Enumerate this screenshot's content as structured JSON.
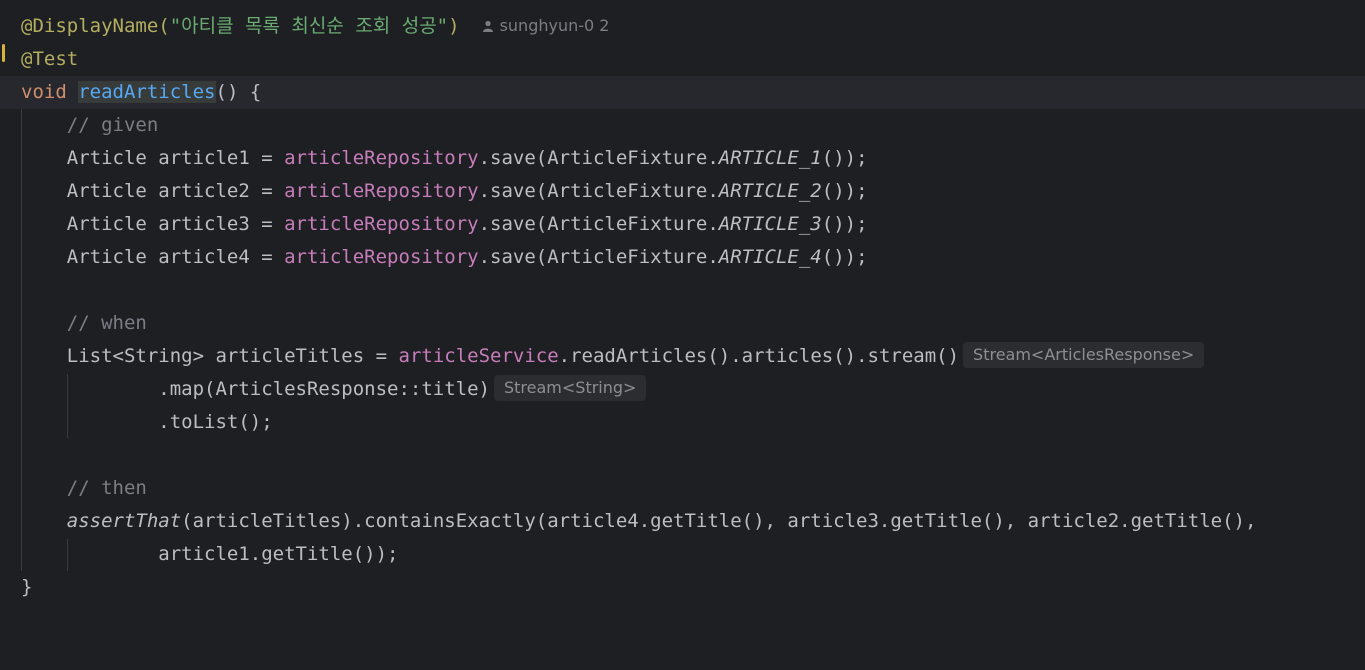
{
  "lines": [
    {
      "a": "@DisplayName(",
      "b": "\"아티클 목록 최신순 조회 성공\"",
      "c": ")"
    },
    {
      "a": "@Test"
    },
    {
      "a": "void",
      "b": " ",
      "c": "readArticles",
      "d": "() {"
    },
    {
      "a": "    // given"
    },
    {
      "a": "    Article article1 = ",
      "b": "articleRepository",
      "c": ".save(ArticleFixture.",
      "d": "ARTICLE_1",
      "e": "());"
    },
    {
      "a": "    Article article2 = ",
      "b": "articleRepository",
      "c": ".save(ArticleFixture.",
      "d": "ARTICLE_2",
      "e": "());"
    },
    {
      "a": "    Article article3 = ",
      "b": "articleRepository",
      "c": ".save(ArticleFixture.",
      "d": "ARTICLE_3",
      "e": "());"
    },
    {
      "a": "    Article article4 = ",
      "b": "articleRepository",
      "c": ".save(ArticleFixture.",
      "d": "ARTICLE_4",
      "e": "());"
    },
    {
      "a": ""
    },
    {
      "a": "    // when"
    },
    {
      "a": "    List<String> articleTitles = ",
      "b": "articleService",
      "c": ".readArticles().articles().stream()"
    },
    {
      "a": "            .map(ArticlesResponse::title)"
    },
    {
      "a": "            .toList();"
    },
    {
      "a": ""
    },
    {
      "a": "    // then"
    },
    {
      "a": "assertThat",
      "b": "(articleTitles).containsExactly(article4.getTitle(), article3.getTitle(), article2.getTitle(),"
    },
    {
      "a": "            article1.getTitle());"
    },
    {
      "a": "}"
    }
  ],
  "indent": "    ",
  "author": {
    "name": "sunghyun-0",
    "count": "2"
  },
  "hints": {
    "stream": "Stream<ArticlesResponse>",
    "map": "Stream<String>"
  },
  "colors": {
    "background": "#1e1f22",
    "keyword": "#cf8e6d",
    "annotation": "#b3ae60",
    "string": "#6aab73",
    "function": "#56a8f5",
    "field": "#c77dbb",
    "comment": "#7a7e85"
  }
}
